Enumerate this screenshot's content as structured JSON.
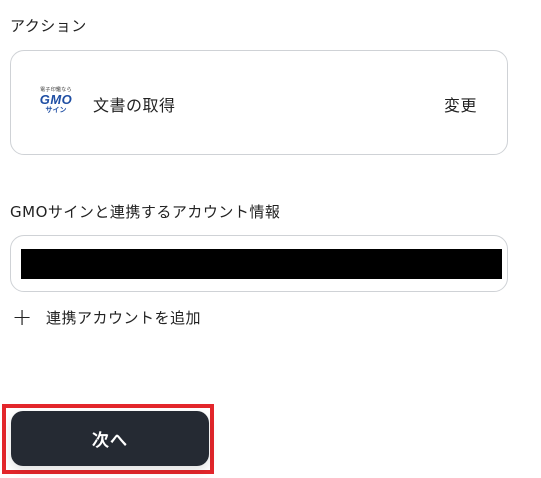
{
  "action_section": {
    "label": "アクション",
    "logo": {
      "tagline": "電子印鑑なら",
      "brand": "GMO",
      "product": "サイン",
      "brand_color": "#1f4ea3"
    },
    "action_name": "文書の取得",
    "change_label": "変更"
  },
  "account_section": {
    "label": "GMOサインと連携するアカウント情報",
    "selected_account": "",
    "add_account_label": "連携アカウントを追加",
    "add_icon": "plus-icon"
  },
  "footer": {
    "next_label": "次へ",
    "button_color": "#252a33",
    "highlight_color": "#e3262b"
  }
}
